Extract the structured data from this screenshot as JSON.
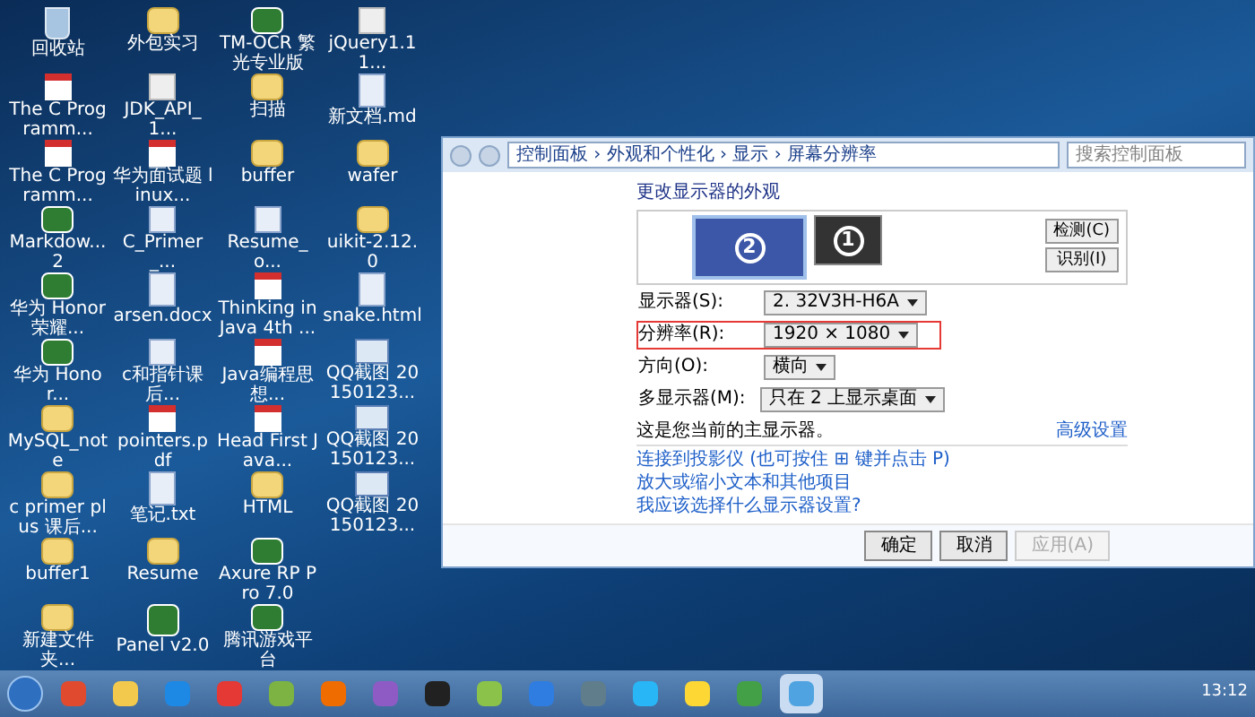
{
  "desktop_columns": [
    [
      {
        "label": "回收站",
        "kind": "bin"
      },
      {
        "label": "The C Programm...",
        "kind": "pdf"
      },
      {
        "label": "The C Programm...",
        "kind": "pdf"
      },
      {
        "label": "Markdow... 2",
        "kind": "app"
      },
      {
        "label": "华为 Honor 荣耀...",
        "kind": "app"
      },
      {
        "label": "华为 Honor...",
        "kind": "app"
      },
      {
        "label": "MySQL_note",
        "kind": "folder"
      },
      {
        "label": "c primer plus 课后...",
        "kind": "folder"
      },
      {
        "label": "buffer1",
        "kind": "folder"
      },
      {
        "label": "新建文件夹...",
        "kind": "folder"
      }
    ],
    [
      {
        "label": "外包实习",
        "kind": "folder"
      },
      {
        "label": "JDK_API_1...",
        "kind": "unknown"
      },
      {
        "label": "华为面试题 linux...",
        "kind": "pdf"
      },
      {
        "label": "C_Primer_...",
        "kind": "doc"
      },
      {
        "label": "arsen.docx",
        "kind": "doc"
      },
      {
        "label": "c和指针课后...",
        "kind": "doc"
      },
      {
        "label": "pointers.pdf",
        "kind": "pdf"
      },
      {
        "label": "笔记.txt",
        "kind": "doc"
      },
      {
        "label": "Resume",
        "kind": "folder"
      },
      {
        "label": "Panel v2.0",
        "kind": "app"
      }
    ],
    [
      {
        "label": "TM-OCR 繁光专业版",
        "kind": "app"
      },
      {
        "label": "扫描",
        "kind": "folder"
      },
      {
        "label": "buffer",
        "kind": "folder"
      },
      {
        "label": "Resume_o...",
        "kind": "doc"
      },
      {
        "label": "Thinking in Java 4th ...",
        "kind": "pdf"
      },
      {
        "label": "Java编程思想...",
        "kind": "pdf"
      },
      {
        "label": "Head First Java...",
        "kind": "pdf"
      },
      {
        "label": "HTML",
        "kind": "folder"
      },
      {
        "label": "Axure RP Pro 7.0",
        "kind": "app"
      },
      {
        "label": "腾讯游戏平台",
        "kind": "app"
      }
    ],
    [
      {
        "label": "jQuery1.11...",
        "kind": "unknown"
      },
      {
        "label": "新文档.md",
        "kind": "doc"
      },
      {
        "label": "wafer",
        "kind": "folder"
      },
      {
        "label": "uikit-2.12.0",
        "kind": "folder"
      },
      {
        "label": "snake.html",
        "kind": "doc"
      },
      {
        "label": "QQ截图 20150123...",
        "kind": "image"
      },
      {
        "label": "QQ截图 20150123...",
        "kind": "image"
      },
      {
        "label": "QQ截图 20150123...",
        "kind": "image"
      }
    ]
  ],
  "window": {
    "address": "控制面板 › 外观和个性化 › 显示 › 屏幕分辨率",
    "search": {
      "placeholder": "搜索控制面板"
    },
    "heading": "更改显示器的外观",
    "monitors": [
      {
        "number": "2",
        "selected": true
      },
      {
        "number": "1",
        "selected": false
      }
    ],
    "side_buttons": [
      "检测(C)",
      "识别(I)"
    ],
    "settings": [
      {
        "label": "显示器(S):",
        "value": "2. 32V3H-H6A",
        "highlighted": false
      },
      {
        "label": "分辨率(R):",
        "value": "1920 × 1080",
        "highlighted": true
      },
      {
        "label": "方向(O):",
        "value": "横向",
        "highlighted": false
      },
      {
        "label": "多显示器(M):",
        "value": "只在 2 上显示桌面",
        "highlighted": false
      }
    ],
    "note": "这是您当前的主显示器。",
    "advanced_link": "高级设置",
    "links": [
      "连接到投影仪 (也可按住 ⊞ 键并点击 P)",
      "放大或缩小文本和其他项目",
      "我应该选择什么显示器设置?"
    ],
    "buttons": [
      {
        "label": "确定",
        "disabled": false
      },
      {
        "label": "取消",
        "disabled": false
      },
      {
        "label": "应用(A)",
        "disabled": true
      }
    ]
  },
  "taskbar": {
    "apps": [
      {
        "color": "#e04b2f",
        "selected": false
      },
      {
        "color": "#f2c94c",
        "selected": false
      },
      {
        "color": "#1e88e5",
        "selected": false
      },
      {
        "color": "#e53935",
        "selected": false
      },
      {
        "color": "#7cb342",
        "selected": false
      },
      {
        "color": "#ef6c00",
        "selected": false
      },
      {
        "color": "#8e5bc4",
        "selected": false
      },
      {
        "color": "#212121",
        "selected": false
      },
      {
        "color": "#8bc34a",
        "selected": false
      },
      {
        "color": "#2f7de1",
        "selected": false
      },
      {
        "color": "#607d8b",
        "selected": false
      },
      {
        "color": "#29b6f6",
        "selected": false
      },
      {
        "color": "#fdd835",
        "selected": false
      },
      {
        "color": "#43a047",
        "selected": false
      },
      {
        "color": "#4fa3e0",
        "selected": true
      }
    ],
    "clock": "13:12"
  }
}
